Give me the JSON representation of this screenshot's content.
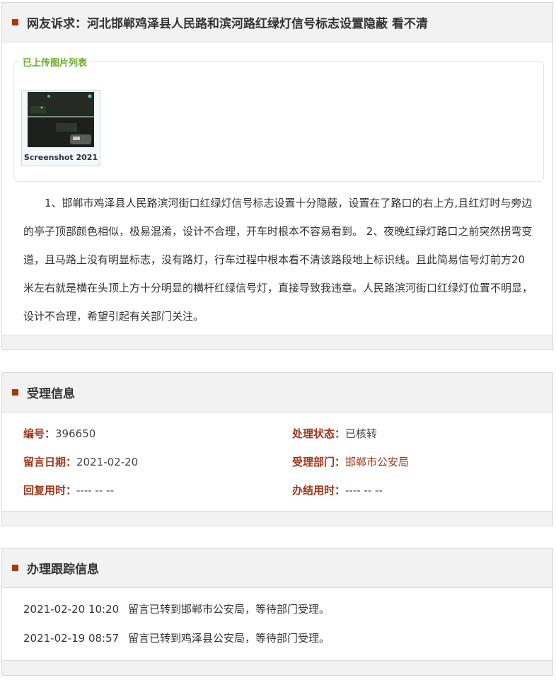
{
  "complaint": {
    "title": "网友诉求：河北邯郸鸡泽县人民路和滨河路红绿灯信号标志设置隐蔽 看不清",
    "upload_legend": "已上传图片列表",
    "thumbnail_caption": "Screenshot 2021",
    "content": "1、邯郸市鸡泽县人民路滨河街口红绿灯信号标志设置十分隐蔽，设置在了路口的右上方,且红灯时与旁边的亭子顶部颜色相似，极易混淆，设计不合理，开车时根本不容易看到。 2、夜晚红绿灯路口之前突然拐弯变道，且马路上没有明显标志，没有路灯，行车过程中根本看不清该路段地上标识线。且此简易信号灯前方20米左右就是横在头顶上方十分明显的横杆红绿信号灯，直接导致我违章。人民路滨河街口红绿灯位置不明显，设计不合理，希望引起有关部门关注。"
  },
  "acceptance": {
    "title": "受理信息",
    "id_label": "编号：",
    "id_value": "396650",
    "status_label": "处理状态：",
    "status_value": "已核转",
    "date_label": "留言日期：",
    "date_value": "2021-02-20",
    "dept_label": "受理部门：",
    "dept_value": "邯郸市公安局",
    "reply_label": "回复用时：",
    "reply_value": "---- -- --",
    "finish_label": "办结用时：",
    "finish_value": "---- -- --"
  },
  "tracking": {
    "title": "办理跟踪信息",
    "items": [
      {
        "time": "2021-02-20 10:20",
        "text": "留言已转到邯郸市公安局，等待部门受理。"
      },
      {
        "time": "2021-02-19 08:57",
        "text": "留言已转到鸡泽县公安局，等待部门受理。"
      }
    ]
  },
  "colors": {
    "accent": "#a43a10",
    "label": "#a0361a",
    "legend_green": "#6aab2a",
    "header_bg": "#f2f2f2"
  }
}
